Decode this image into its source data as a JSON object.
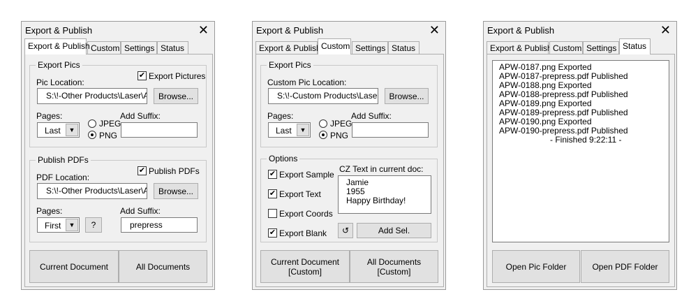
{
  "window_title": "Export & Publish",
  "tabs": [
    "Export & Publish",
    "Custom",
    "Settings",
    "Status"
  ],
  "dialog1": {
    "export_pics": {
      "legend": "Export Pics",
      "checkbox_label": "Export Pictures",
      "checked": true,
      "location_label": "Pic Location:",
      "location_value": "S:\\!-Other Products\\Laser\\APW",
      "browse": "Browse...",
      "pages_label": "Pages:",
      "pages_value": "Last",
      "jpeg": "JPEG",
      "png": "PNG",
      "format_selected": "PNG",
      "suffix_label": "Add Suffix:",
      "suffix_value": ""
    },
    "publish_pdfs": {
      "legend": "Publish PDFs",
      "checkbox_label": "Publish PDFs",
      "checked": true,
      "location_label": "PDF Location:",
      "location_value": "S:\\!-Other Products\\Laser\\APW",
      "browse": "Browse...",
      "pages_label": "Pages:",
      "pages_value": "First",
      "help": "?",
      "suffix_label": "Add Suffix:",
      "suffix_value": "prepress"
    },
    "current_document": "Current Document",
    "all_documents": "All Documents"
  },
  "dialog2": {
    "export_pics": {
      "legend": "Export Pics",
      "location_label": "Custom Pic Location:",
      "location_value": "S:\\!-Custom Products\\Laser\\A",
      "browse": "Browse...",
      "pages_label": "Pages:",
      "pages_value": "Last",
      "jpeg": "JPEG",
      "png": "PNG",
      "format_selected": "PNG",
      "suffix_label": "Add Suffix:",
      "suffix_value": ""
    },
    "options": {
      "legend": "Options",
      "checkboxes": [
        {
          "label": "Export Sample",
          "checked": true
        },
        {
          "label": "Export Text",
          "checked": true
        },
        {
          "label": "Export Coords",
          "checked": false
        },
        {
          "label": "Export Blank",
          "checked": true
        }
      ],
      "cz_label": "CZ Text in current doc:",
      "cz_lines": [
        "Jamie",
        "1955",
        "Happy Birthday!"
      ],
      "refresh_icon": "↺",
      "add_sel": "Add Sel."
    },
    "current_document": [
      "Current Document",
      "[Custom]"
    ],
    "all_documents": [
      "All Documents",
      "[Custom]"
    ]
  },
  "dialog3": {
    "status_lines": [
      "APW-0187.png Exported",
      "APW-0187-prepress.pdf Published",
      "APW-0188.png Exported",
      "APW-0188-prepress.pdf Published",
      "APW-0189.png Exported",
      "APW-0189-prepress.pdf Published",
      "APW-0190.png Exported",
      "APW-0190-prepress.pdf Published"
    ],
    "finished": "- Finished 9:22:11 -",
    "open_pic_folder": "Open Pic Folder",
    "open_pdf_folder": "Open PDF Folder"
  }
}
